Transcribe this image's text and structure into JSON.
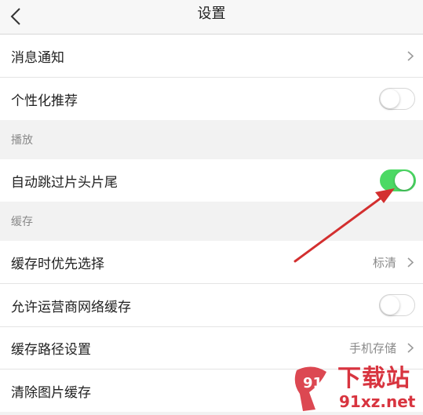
{
  "header": {
    "title": "设置"
  },
  "rows": {
    "notifications": {
      "label": "消息通知"
    },
    "personalized": {
      "label": "个性化推荐",
      "toggle": "off"
    },
    "skip_intro": {
      "label": "自动跳过片头片尾",
      "toggle": "on"
    },
    "cache_priority": {
      "label": "缓存时优先选择",
      "value": "标清"
    },
    "carrier_cache": {
      "label": "允许运营商网络缓存",
      "toggle": "off"
    },
    "cache_path": {
      "label": "缓存路径设置",
      "value": "手机存储"
    },
    "clear_images": {
      "label": "清除图片缓存"
    }
  },
  "sections": {
    "playback": "播放",
    "cache": "缓存"
  },
  "watermark": {
    "brand": "下载站",
    "domain": "91xz.net",
    "logo_text": "91"
  },
  "colors": {
    "toggle_on": "#4cd964",
    "annotation_arrow": "#d32f2f",
    "watermark": "#d8343f"
  }
}
